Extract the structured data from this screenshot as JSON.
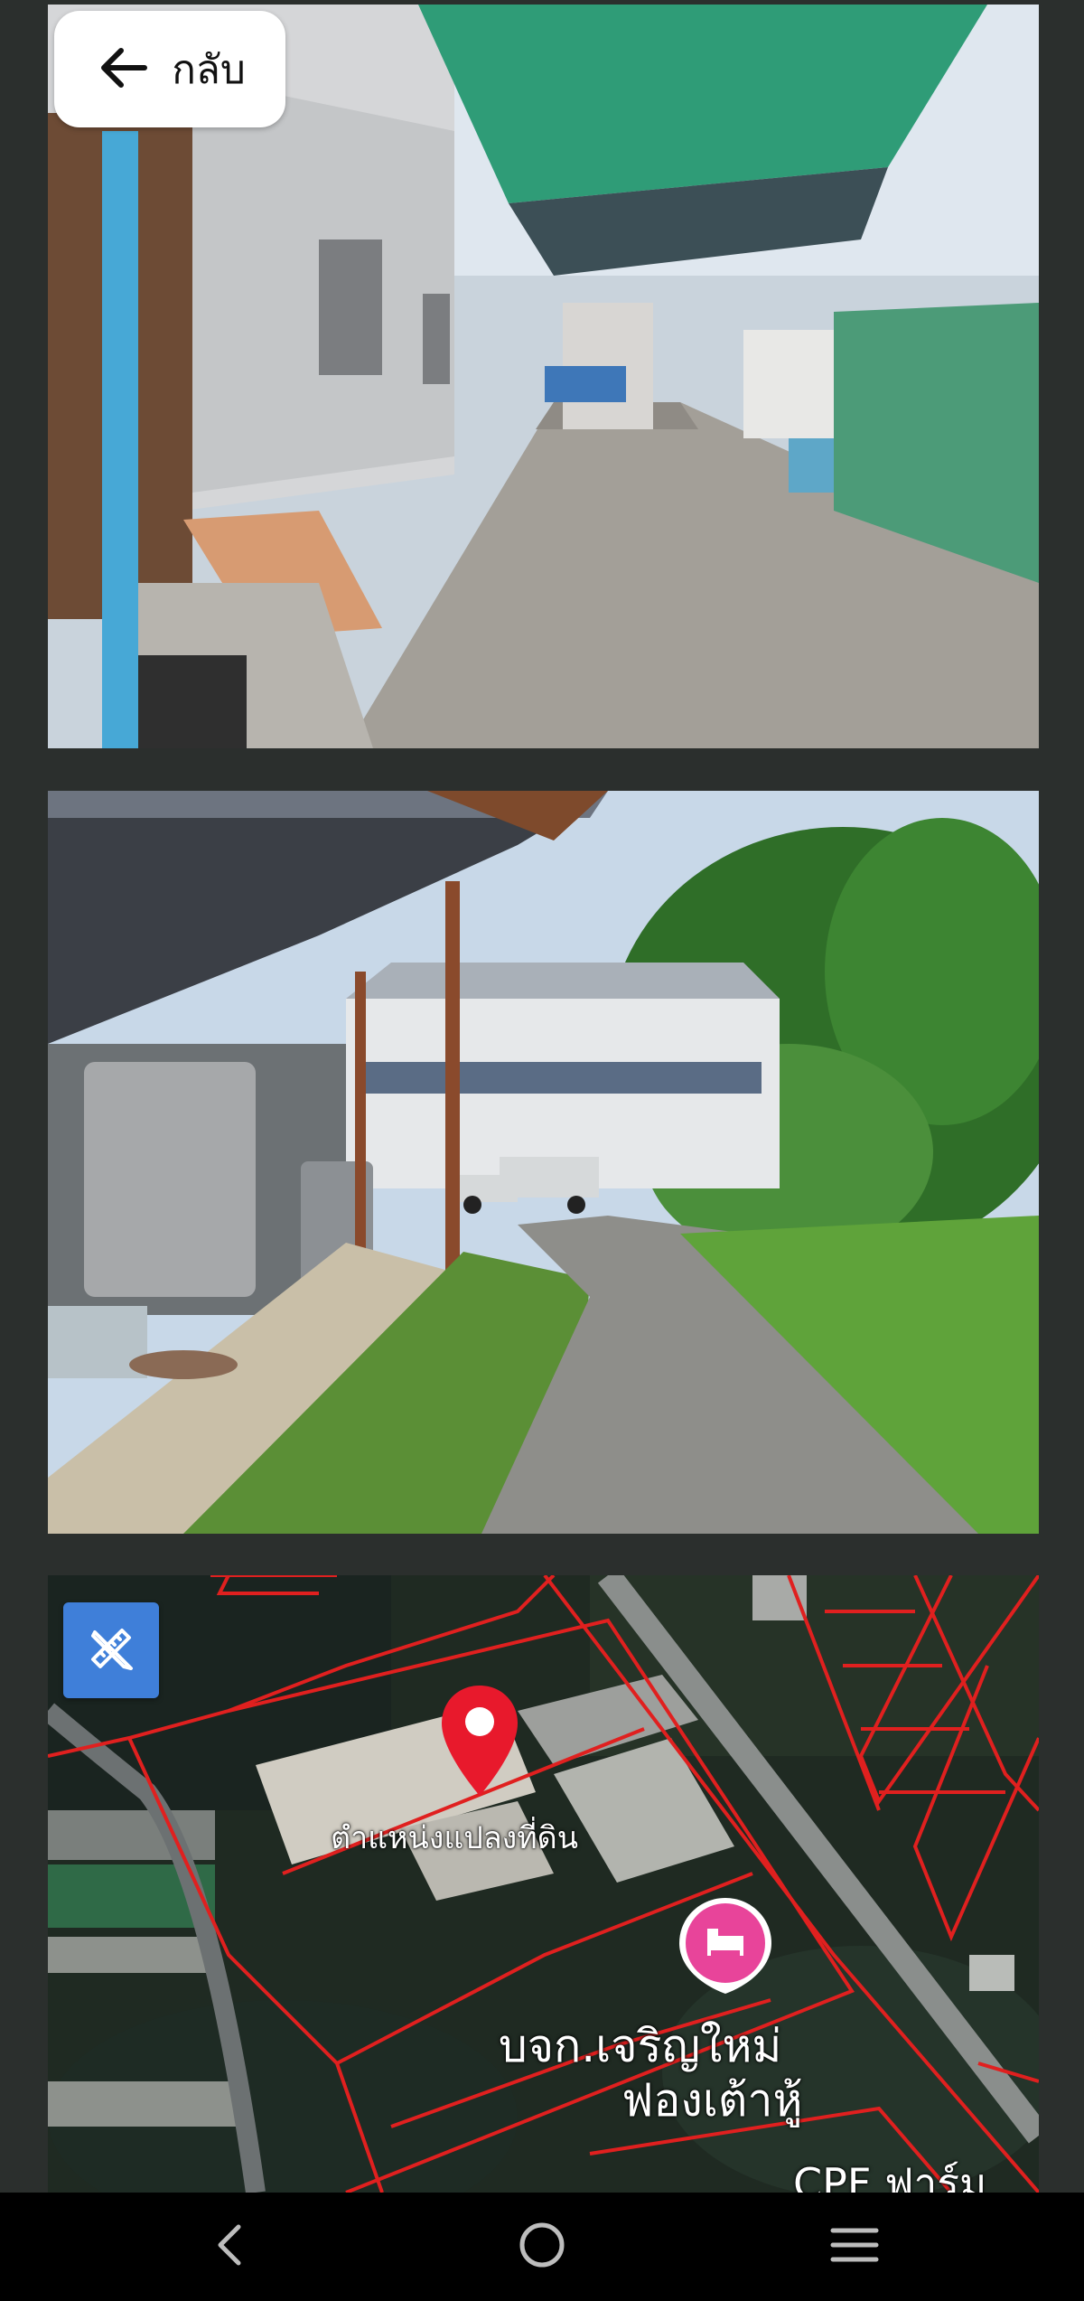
{
  "header": {
    "back_label": "กลับ",
    "back_icon": "arrow-left-icon"
  },
  "photos": [
    {
      "name": "alley-photo",
      "description_icon": "photo"
    },
    {
      "name": "factory-yard-photo",
      "description_icon": "photo"
    }
  ],
  "map": {
    "tool_icon": "ruler-pencil-icon",
    "parcel_label": "ตำแหน่งแปลงที่ดิน",
    "place_label_line1": "บจก.เจริญใหม่",
    "place_label_line2": "ฟองเต้าหู้",
    "bottom_label": "CPF ฟาร์ม",
    "pin_color": "#e8192c",
    "place_pin_color": "#e8449a",
    "boundary_color": "#e0201f"
  },
  "navbar": {
    "back_icon": "nav-back-icon",
    "home_icon": "nav-home-icon",
    "menu_icon": "nav-menu-icon"
  }
}
